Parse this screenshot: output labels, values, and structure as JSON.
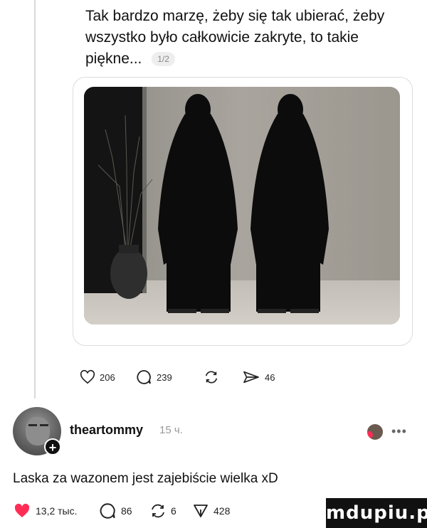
{
  "post": {
    "text": "Tak bardzo marzę, żeby się tak ubierać, żeby wszystko było całkowicie zakryte, to takie piękne...",
    "page_counter": "1/2",
    "actions": {
      "likes": "206",
      "comments": "239",
      "reposts": "",
      "shares": "46"
    }
  },
  "reply": {
    "username": "theartommy",
    "timestamp": "15 ч.",
    "comment": "Laska za wazonem jest zajebiście wielka xD",
    "actions": {
      "likes": "13,2 тыс.",
      "comments": "86",
      "reposts": "6",
      "shares": "428"
    }
  },
  "watermark": "mdupiu.pl",
  "colors": {
    "like_red": "#ff2d55",
    "text": "#111111",
    "muted": "#999999"
  }
}
